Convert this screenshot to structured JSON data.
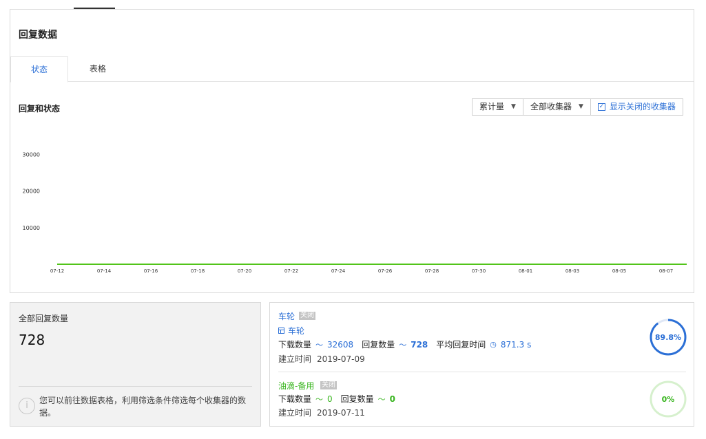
{
  "panel": {
    "title": "回复数据",
    "tabs": [
      {
        "label": "状态",
        "active": true
      },
      {
        "label": "表格",
        "active": false
      }
    ]
  },
  "chart_section": {
    "title": "回复和状态",
    "controls": {
      "mode_label": "累计量",
      "collector_label": "全部收集器",
      "show_closed_label": "显示关闭的收集器",
      "show_closed_checked": true
    }
  },
  "chart_data": {
    "type": "line",
    "x": [
      "07-12",
      "07-14",
      "07-16",
      "07-18",
      "07-20",
      "07-22",
      "07-24",
      "07-26",
      "07-28",
      "07-30",
      "08-01",
      "08-03",
      "08-05",
      "08-07"
    ],
    "series": [
      {
        "values": [
          0,
          0,
          0,
          0,
          0,
          0,
          0,
          0,
          0,
          0,
          0,
          0,
          0,
          0
        ],
        "color": "#52c41a"
      }
    ],
    "yticks": [
      10000,
      20000,
      30000
    ],
    "ylim": [
      0,
      35000
    ],
    "grid": false
  },
  "summary": {
    "label": "全部回复数量",
    "value": "728",
    "hint": "您可以前往数据表格，利用筛选条件筛选每个收集器的数据。"
  },
  "collectors": [
    {
      "name": "车轮",
      "badge": "关闭",
      "sub_name": "车轮",
      "download_label": "下载数量",
      "download_value": "32608",
      "reply_label": "回复数量",
      "reply_value": "728",
      "avg_label": "平均回复时间",
      "avg_value": "871.3 s",
      "created_label": "建立时间",
      "created_value": "2019-07-09",
      "ring_text": "89.8%",
      "ring_fraction": 0.898,
      "color": "#2b6fd6"
    },
    {
      "name": "油滴-备用",
      "badge": "关闭",
      "download_label": "下载数量",
      "download_value": "0",
      "reply_label": "回复数量",
      "reply_value": "0",
      "created_label": "建立时间",
      "created_value": "2019-07-11",
      "ring_text": "0%",
      "ring_fraction": 0,
      "color": "#39b51f"
    }
  ]
}
